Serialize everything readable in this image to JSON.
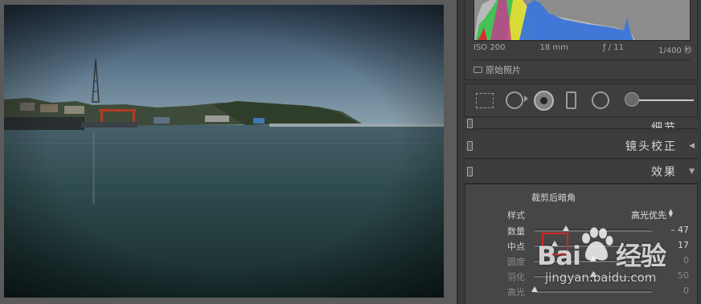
{
  "exif": {
    "iso": "ISO 200",
    "focal_length": "18 mm",
    "aperture": "ƒ / 11",
    "shutter": "1/400 秒"
  },
  "original_photo_label": "原始照片",
  "sections": {
    "detail": "细节",
    "lens": "镜头校正",
    "effects": "效果"
  },
  "effects": {
    "vignette_title": "裁剪后暗角",
    "style_label": "样式",
    "style_value": "高光优先",
    "sliders": [
      {
        "label": "数量",
        "value": "– 47",
        "level": -47,
        "min": -100,
        "max": 100
      },
      {
        "label": "中点",
        "value": "17",
        "level": 17,
        "min": 0,
        "max": 100
      },
      {
        "label": "圆度",
        "value": "0",
        "level": 0,
        "min": -100,
        "max": 100
      },
      {
        "label": "羽化",
        "value": "50",
        "level": 50,
        "min": 0,
        "max": 100
      },
      {
        "label": "高光",
        "value": "0",
        "level": 0,
        "min": 0,
        "max": 100
      }
    ]
  },
  "watermark": {
    "brand_left": "Bai",
    "brand_right": "经验",
    "url": "jingyan.baidu.com"
  },
  "colors": {
    "panel_bg": "#3a3a3a",
    "highlight": "#d32626"
  }
}
